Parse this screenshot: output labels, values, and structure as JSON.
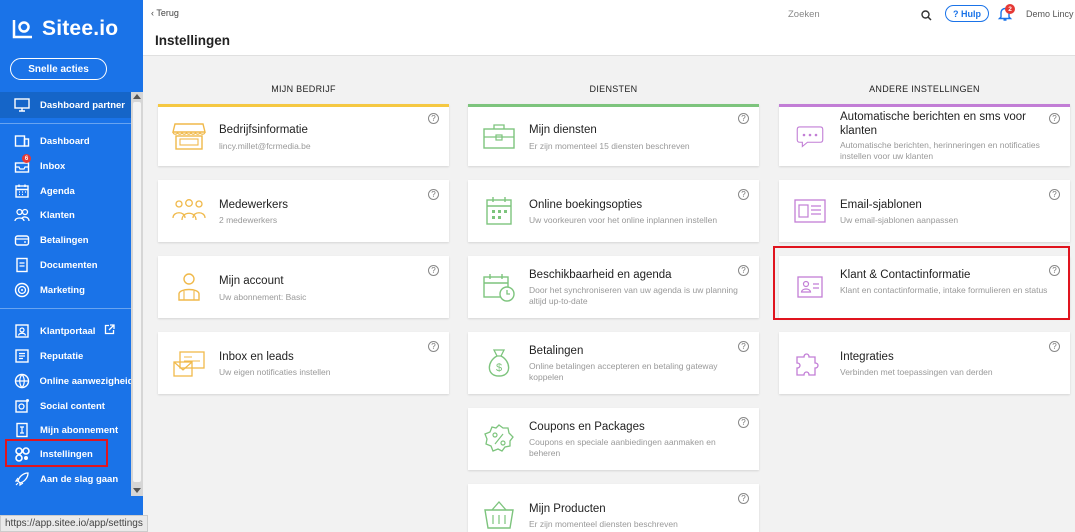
{
  "app": {
    "brand": "Sitee.io",
    "quick_actions": "Snelle acties",
    "status_url": "https://app.sitee.io/app/settings"
  },
  "sidebar": {
    "partner": {
      "label": "Dashboard partner",
      "icon": "monitor-icon"
    },
    "items": [
      {
        "label": "Dashboard",
        "icon": "dashboard-icon"
      },
      {
        "label": "Inbox",
        "icon": "inbox-icon",
        "badge": "6"
      },
      {
        "label": "Agenda",
        "icon": "calendar-icon"
      },
      {
        "label": "Klanten",
        "icon": "users-icon"
      },
      {
        "label": "Betalingen",
        "icon": "wallet-icon"
      },
      {
        "label": "Documenten",
        "icon": "document-icon"
      },
      {
        "label": "Marketing",
        "icon": "target-icon"
      }
    ],
    "items2": [
      {
        "label": "Klantportaal",
        "icon": "portal-icon"
      },
      {
        "label": "Reputatie",
        "icon": "reputation-icon"
      },
      {
        "label": "Online aanwezigheid",
        "icon": "globe-icon"
      },
      {
        "label": "Social content",
        "icon": "social-icon"
      },
      {
        "label": "Mijn abonnement",
        "icon": "subscription-icon"
      },
      {
        "label": "Instellingen",
        "icon": "settings-icon"
      },
      {
        "label": "Aan de slag gaan",
        "icon": "rocket-icon"
      }
    ]
  },
  "topbar": {
    "back": "‹ Terug",
    "title": "Instellingen",
    "search_placeholder": "Zoeken",
    "help": "? Hulp",
    "notifications": "2",
    "user": "Demo Lincy"
  },
  "columns": [
    {
      "header": "MIJN BEDRIJF",
      "accent": "#f5c842",
      "cards": [
        {
          "title": "Bedrijfsinformatie",
          "subtitle": "lincy.millet@fcrmedia.be",
          "icon": "store-icon"
        },
        {
          "title": "Medewerkers",
          "subtitle": "2 medewerkers",
          "icon": "team-icon"
        },
        {
          "title": "Mijn account",
          "subtitle": "Uw abonnement: Basic",
          "icon": "account-icon"
        },
        {
          "title": "Inbox en leads",
          "subtitle": "Uw eigen notificaties instellen",
          "icon": "leads-icon"
        }
      ]
    },
    {
      "header": "DIENSTEN",
      "accent": "#7dc47d",
      "cards": [
        {
          "title": "Mijn diensten",
          "subtitle": "Er zijn momenteel 15 diensten beschreven",
          "icon": "briefcase-icon"
        },
        {
          "title": "Online boekingsopties",
          "subtitle": "Uw voorkeuren voor het online inplannen instellen",
          "icon": "calendar-grid-icon"
        },
        {
          "title": "Beschikbaarheid en agenda",
          "subtitle": "Door het synchroniseren van uw agenda is uw planning altijd up-to-date",
          "icon": "calendar-clock-icon"
        },
        {
          "title": "Betalingen",
          "subtitle": "Online betalingen accepteren en betaling gateway koppelen",
          "icon": "money-bag-icon"
        },
        {
          "title": "Coupons en Packages",
          "subtitle": "Coupons en speciale aanbiedingen aanmaken en beheren",
          "icon": "coupon-icon"
        },
        {
          "title": "Mijn Producten",
          "subtitle": "Er zijn momenteel diensten beschreven",
          "icon": "basket-icon"
        }
      ]
    },
    {
      "header": "ANDERE INSTELLINGEN",
      "accent": "#c27ed6",
      "cards": [
        {
          "title": "Automatische berichten en sms voor klanten",
          "subtitle": "Automatische berichten, herinneringen en notificaties instellen voor uw klanten",
          "icon": "chat-icon"
        },
        {
          "title": "Email-sjablonen",
          "subtitle": "Uw email-sjablonen aanpassen",
          "icon": "template-icon"
        },
        {
          "title": "Klant & Contactinformatie",
          "subtitle": "Klant en contactinformatie, intake formulieren en status",
          "icon": "contact-card-icon"
        },
        {
          "title": "Integraties",
          "subtitle": "Verbinden met toepassingen van derden",
          "icon": "puzzle-icon"
        }
      ]
    }
  ],
  "colors": {
    "sidebar": "#1a73e8",
    "highlight": "#e0141e",
    "icon_tint": "#f0b94a",
    "icon_green": "#7dc47d",
    "icon_purple": "#c27ed6"
  }
}
